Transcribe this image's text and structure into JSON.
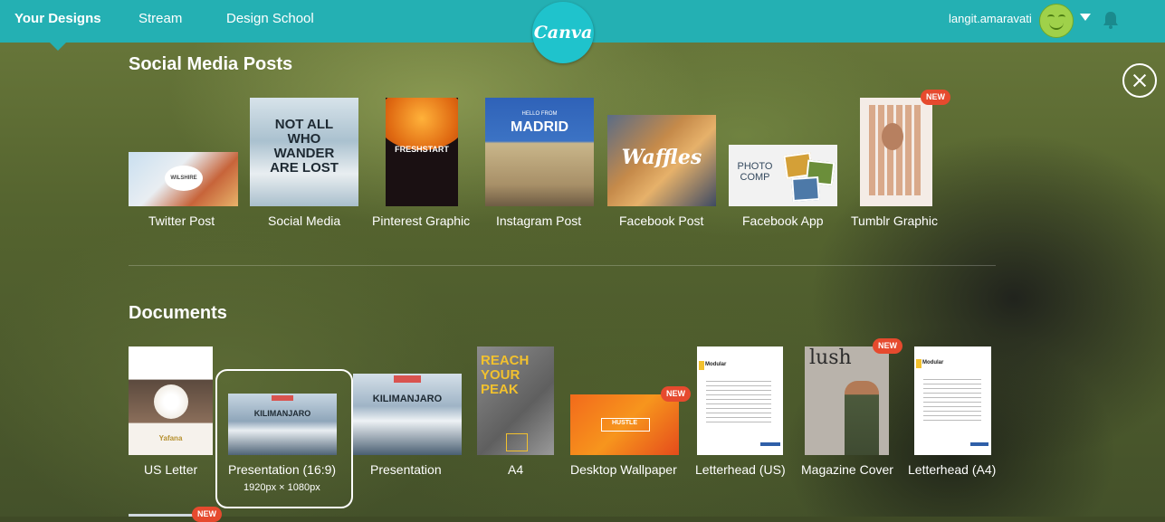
{
  "nav": {
    "your_designs": "Your Designs",
    "stream": "Stream",
    "design_school": "Design School"
  },
  "logo": {
    "text": "Canva"
  },
  "user": {
    "name": "langit.amaravati"
  },
  "sections": {
    "social": "Social Media Posts",
    "documents": "Documents"
  },
  "social_items": [
    {
      "label": "Twitter Post",
      "thumb": "WILSHIRE"
    },
    {
      "label": "Social Media",
      "thumb": "NOT ALL WHO WANDER ARE LOST"
    },
    {
      "label": "Pinterest Graphic",
      "thumb": "FRESHSTART"
    },
    {
      "label": "Instagram Post",
      "thumb_small": "HELLO FROM",
      "thumb": "MADRID"
    },
    {
      "label": "Facebook Post",
      "thumb": "Waffles"
    },
    {
      "label": "Facebook App",
      "thumb": "PHOTO COMP"
    },
    {
      "label": "Tumblr Graphic",
      "badge": "NEW"
    }
  ],
  "document_items": [
    {
      "label": "US Letter",
      "thumb": "Yafana"
    },
    {
      "label": "Presentation (16:9)",
      "thumb": "KILIMANJARO",
      "sub": "1920px × 1080px"
    },
    {
      "label": "Presentation",
      "thumb": "KILIMANJARO"
    },
    {
      "label": "A4",
      "thumb": "REACH YOUR PEAK"
    },
    {
      "label": "Desktop Wallpaper",
      "thumb": "HUSTLE",
      "badge": "NEW"
    },
    {
      "label": "Letterhead (US)",
      "thumb": "Modular"
    },
    {
      "label": "Magazine Cover",
      "thumb": "lush",
      "badge": "NEW"
    },
    {
      "label": "Letterhead (A4)",
      "thumb": "Modular"
    }
  ],
  "bottom_badge": "NEW",
  "colors": {
    "topbar": "#24b0b3",
    "logo": "#1fc3cc",
    "badge": "#e64a2e"
  }
}
